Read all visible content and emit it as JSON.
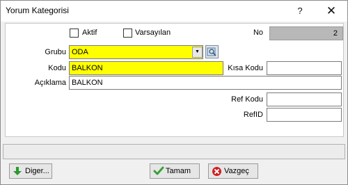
{
  "window": {
    "title": "Yorum Kategorisi",
    "help_glyph": "?",
    "close_glyph": "✕"
  },
  "form": {
    "aktif": {
      "label": "Aktif",
      "checked": false
    },
    "varsayilan": {
      "label": "Varsayılan",
      "checked": false
    },
    "no": {
      "label": "No",
      "value": "2"
    },
    "grubu": {
      "label": "Grubu",
      "value": "ODA"
    },
    "kodu": {
      "label": "Kodu",
      "value": "BALKON"
    },
    "kisa_kodu": {
      "label": "Kısa Kodu",
      "value": ""
    },
    "aciklama": {
      "label": "Açıklama",
      "value": "BALKON"
    },
    "ref_kodu": {
      "label": "Ref Kodu",
      "value": ""
    },
    "refid": {
      "label": "RefID",
      "value": ""
    }
  },
  "statusbar": {
    "text": ""
  },
  "buttons": {
    "diger": {
      "label": "Diger...",
      "icon": "arrow-down-icon",
      "color": "#2a9a2a"
    },
    "tamam": {
      "label": "Tamam",
      "icon": "checkmark-icon",
      "color": "#3aa03a"
    },
    "vazgec": {
      "label": "Vazgeç",
      "icon": "cancel-icon",
      "color": "#d02020"
    }
  },
  "colors": {
    "highlight": "#ffff00",
    "no_field": "#b8b8b8"
  }
}
